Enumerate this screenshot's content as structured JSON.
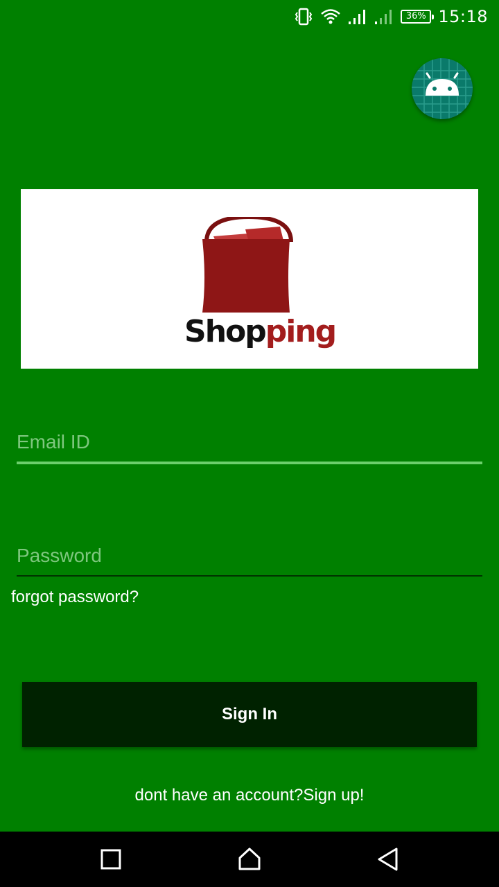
{
  "status_bar": {
    "battery_percent": "36%",
    "time": "15:18",
    "icons": [
      "vibrate-icon",
      "wifi-icon",
      "signal-icon",
      "signal-weak-icon",
      "battery-icon"
    ]
  },
  "fab": {
    "icon": "android-icon"
  },
  "logo": {
    "text_dark": "Shop",
    "text_accent": "ping",
    "bag_color": "#8e1616"
  },
  "form": {
    "email_placeholder": "Email ID",
    "password_placeholder": "Password",
    "forgot_label": "forgot password?",
    "signin_label": "Sign In",
    "signup_label": "dont have an account?Sign up!"
  },
  "nav_bar": {
    "icons": [
      "recent-apps-icon",
      "home-icon",
      "back-icon"
    ]
  },
  "colors": {
    "background": "#008000",
    "button": "#002200",
    "fab": "#0a7a6a",
    "accent_text": "#a31d1d"
  }
}
